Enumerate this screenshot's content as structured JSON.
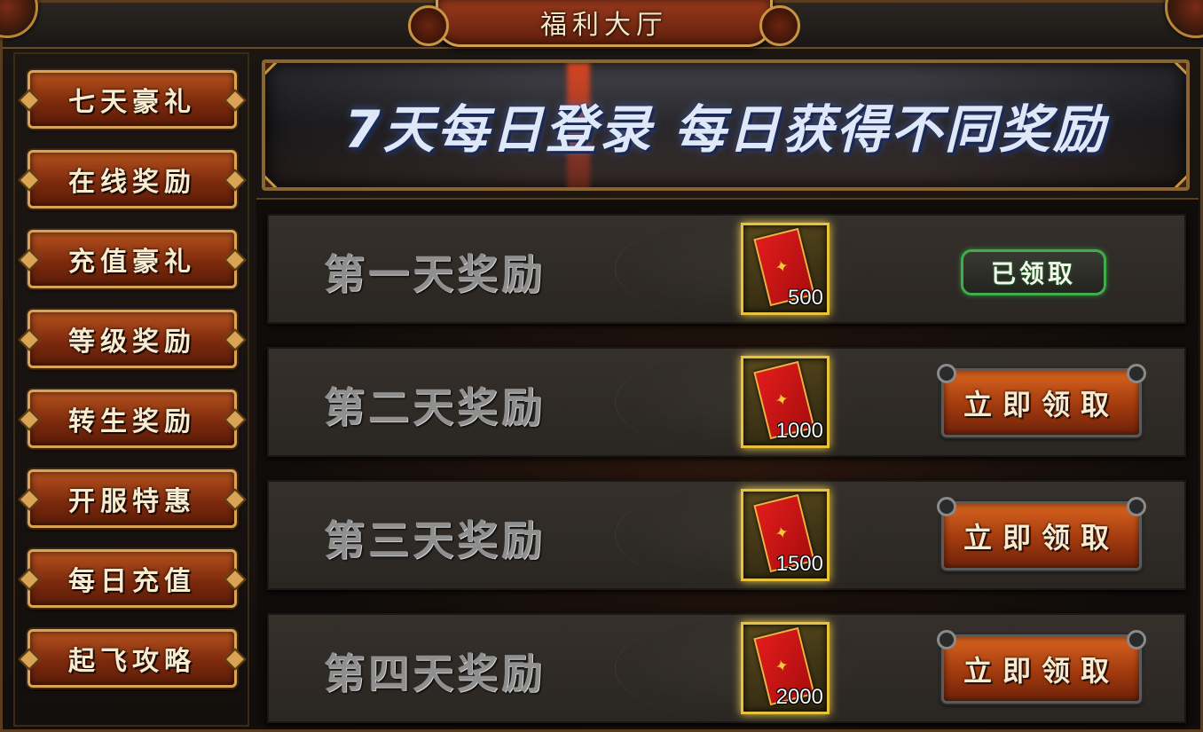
{
  "header": {
    "title": "福利大厅"
  },
  "sidebar": {
    "items": [
      {
        "label": "七天豪礼"
      },
      {
        "label": "在线奖励"
      },
      {
        "label": "充值豪礼"
      },
      {
        "label": "等级奖励"
      },
      {
        "label": "转生奖励"
      },
      {
        "label": "开服特惠"
      },
      {
        "label": "每日充值"
      },
      {
        "label": "起飞攻略"
      }
    ]
  },
  "banner": {
    "text": "7天每日登录  每日获得不同奖励"
  },
  "rewards": [
    {
      "label": "第一天奖励",
      "item_icon": "red-envelope-icon",
      "count": "500",
      "status": "已领取"
    },
    {
      "label": "第二天奖励",
      "item_icon": "red-envelope-icon",
      "count": "1000",
      "button": "立即领取"
    },
    {
      "label": "第三天奖励",
      "item_icon": "red-envelope-icon",
      "count": "1500",
      "button": "立即领取"
    },
    {
      "label": "第四天奖励",
      "item_icon": "red-envelope-icon",
      "count": "2000",
      "button": "立即领取"
    }
  ],
  "colors": {
    "accent_gold": "#d9a555",
    "claimed_green": "#3fae4a",
    "button_orange": "#d8641f"
  }
}
